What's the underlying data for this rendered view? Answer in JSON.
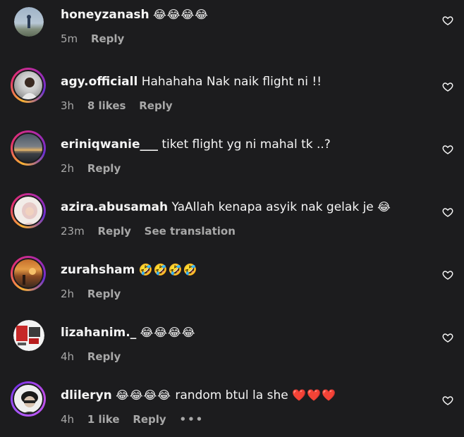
{
  "comments": [
    {
      "username": "honeyzanash",
      "text": "",
      "emoji": "😂😂😂😂",
      "time": "5m",
      "likes": "",
      "reply": "Reply",
      "extra": ""
    },
    {
      "username": "agy.officiall",
      "text": "Hahahaha Nak naik flight ni !!",
      "emoji": "",
      "time": "3h",
      "likes": "8 likes",
      "reply": "Reply",
      "extra": ""
    },
    {
      "username": "eriniqwanie___",
      "text": "tiket flight yg ni mahal tk ..?",
      "emoji": "",
      "time": "2h",
      "likes": "",
      "reply": "Reply",
      "extra": ""
    },
    {
      "username": "azira.abusamah",
      "text": "YaAllah kenapa asyik nak gelak je",
      "emoji": "😂",
      "time": "23m",
      "likes": "",
      "reply": "Reply",
      "extra": "See translation"
    },
    {
      "username": "zurahsham",
      "text": "",
      "emoji": "🤣🤣🤣🤣",
      "time": "2h",
      "likes": "",
      "reply": "Reply",
      "extra": ""
    },
    {
      "username": "lizahanim._",
      "text": "",
      "emoji": "😂😂😂😂",
      "time": "4h",
      "likes": "",
      "reply": "Reply",
      "extra": ""
    },
    {
      "username": "dlileryn",
      "text": "random btul la she",
      "emoji_before": "😂😂😂😂",
      "emoji": "❤️❤️❤️",
      "time": "4h",
      "likes": "1 like",
      "reply": "Reply",
      "extra": "•••"
    }
  ],
  "colors": {
    "background": "#1c1c1e",
    "text_primary": "#f5f5f5",
    "text_secondary": "#a8a8a8"
  },
  "icons": {
    "like": "heart-outline-icon"
  }
}
